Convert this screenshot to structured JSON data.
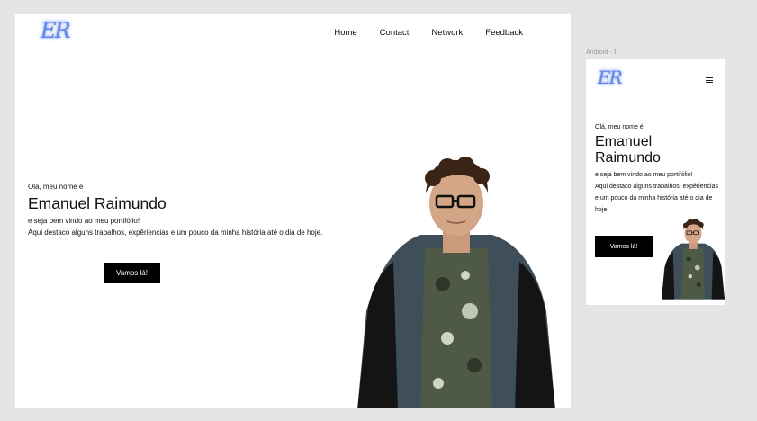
{
  "site": {
    "logo_text": "ER",
    "nav": [
      "Home",
      "Contact",
      "Network",
      "Feedback"
    ]
  },
  "hero": {
    "greeting": "Olá, meu nome é",
    "name": "Emanuel Raimundo",
    "welcome": "e seja bem vindo ao meu portifólio!",
    "description": "Aqui destaco alguns trabalhos, expêriencias e um pouco da minha história até o dia de hoje.",
    "cta": "Vamos lá!"
  },
  "mobile": {
    "frame_label": "Android - 1",
    "desc_lines": [
      "Aqui destaco alguns trabalhos, expêriencias",
      "e um pouco da minha história até o dia de",
      "hoje."
    ]
  },
  "icons": [
    "menu-icon",
    "logo-mark"
  ],
  "colors": {
    "accent": "#5f86e6",
    "button": "#000000",
    "canvas": "#e5e5e5"
  }
}
